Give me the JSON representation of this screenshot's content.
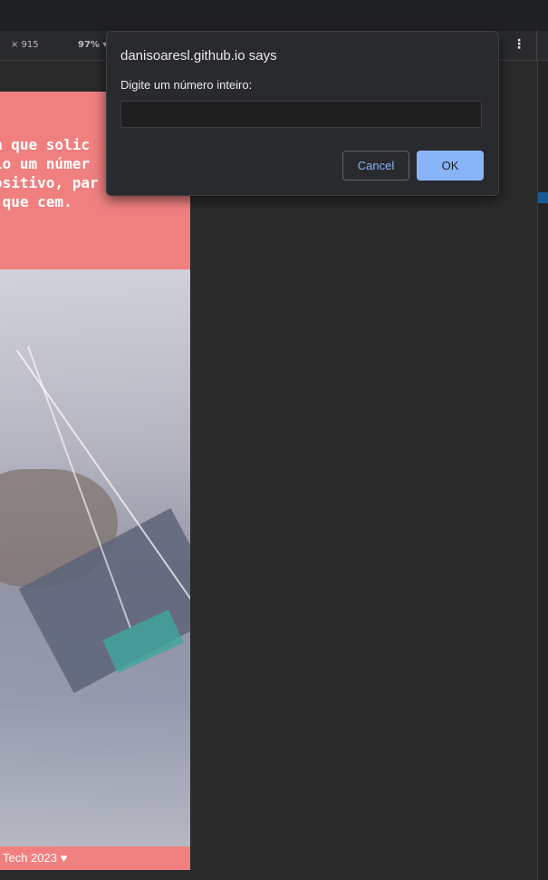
{
  "devtools_bar": {
    "dimensions": "× 915",
    "zoom": "97% ▾",
    "menu_icon": "⋮"
  },
  "page": {
    "hero_text": "a que solic\nlo um númer\nositivo, par e\n que cem.",
    "footer_text": "Tech 2023 ♥",
    "colors": {
      "accent": "#f08080"
    }
  },
  "dialog": {
    "title": "danisoaresl.github.io says",
    "message": "Digite um número inteiro:",
    "input_value": "",
    "cancel_label": "Cancel",
    "ok_label": "OK"
  }
}
